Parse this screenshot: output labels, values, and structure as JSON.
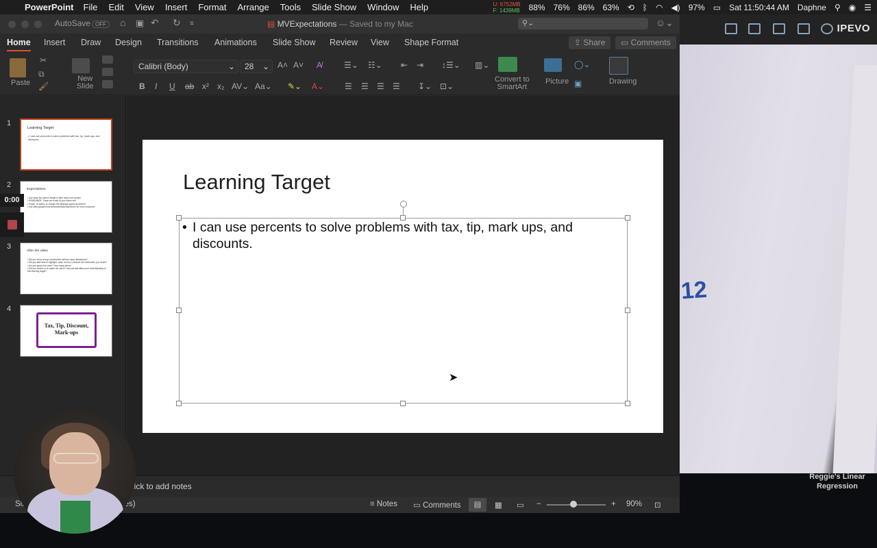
{
  "menubar": {
    "app": "PowerPoint",
    "menus": [
      "File",
      "Edit",
      "View",
      "Insert",
      "Format",
      "Arrange",
      "Tools",
      "Slide Show",
      "Window",
      "Help"
    ],
    "mem_used": "U: 6752MB",
    "mem_free": "F: 1439MB",
    "stats": [
      "88%",
      "76%",
      "86%",
      "63%"
    ],
    "battery": "97%",
    "clock": "Sat 11:50:44 AM",
    "user": "Daphne"
  },
  "titlebar": {
    "autosave": "AutoSave",
    "autosave_state": "OFF",
    "doc_name": "MVExpectations",
    "doc_status": "— Saved to my Mac"
  },
  "tabs": [
    "Home",
    "Insert",
    "Draw",
    "Design",
    "Transitions",
    "Animations",
    "Slide Show",
    "Review",
    "View",
    "Shape Format"
  ],
  "tab_active": "Home",
  "share_label": "Share",
  "comments_label": "Comments",
  "ribbon": {
    "paste": "Paste",
    "new_slide_1": "New",
    "new_slide_2": "Slide",
    "font": "Calibri (Body)",
    "size": "28",
    "convert_1": "Convert to",
    "convert_2": "SmartArt",
    "picture": "Picture",
    "drawing": "Drawing"
  },
  "slides": [
    {
      "num": "1",
      "title": "Learning Target",
      "body": [
        "I can use percents to solve problems with tax, tip, mark ups, and discounts."
      ]
    },
    {
      "num": "2",
      "title": "Expectations",
      "body": [
        "Use twice the video's length to take notes and wonder",
        "REMEMBER: These are notes to your future self",
        "Pause, re-watch, or change the playback speed as desired",
        "Use sites.google.com/view/mathclass/help/home for more resources"
      ]
    },
    {
      "num": "3",
      "title": "After the video",
      "body": [
        "Did you focus and go somewhere without many distractions?",
        "Did you take time to highlight, write, and try to absorb the information you heard?",
        "Did you pause the video? How many times?",
        "Did you rewind or re-watch the video? How did that affect your understanding of this learning target?"
      ]
    },
    {
      "num": "4",
      "title": "Tax, Tip, Discount, Mark-ups",
      "body": []
    }
  ],
  "recording_time": "0:00",
  "main_slide": {
    "title": "Learning Target",
    "bullet": "I can use percents to solve problems with tax, tip, mark ups, and discounts."
  },
  "notes_placeholder": "lick to add notes",
  "status": {
    "left": "Slid",
    "left2": "ates)",
    "notes": "Notes",
    "comments": "Comments",
    "zoom": "90%"
  },
  "ipevo": {
    "logo": "IPEVO",
    "caption_1": "Reggie's Linear",
    "caption_2": "Regression",
    "mark": "12"
  }
}
